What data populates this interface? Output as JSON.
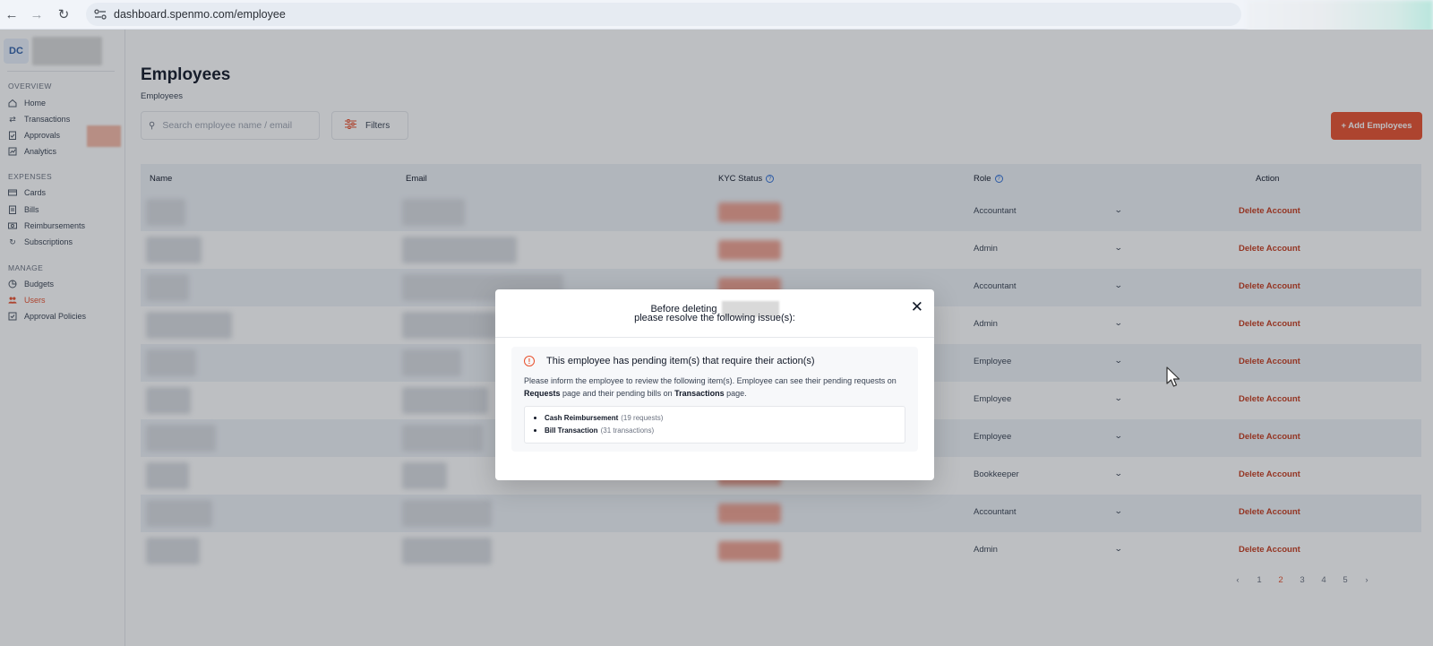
{
  "browser": {
    "url": "dashboard.spenmo.com/employee",
    "back_icon": "arrow-left-icon",
    "forward_icon": "arrow-right-icon",
    "reload_icon": "reload-icon"
  },
  "sidebar": {
    "org_initials": "DC",
    "sections": [
      {
        "title": "OVERVIEW",
        "items": [
          {
            "label": "Home",
            "icon": "home-icon"
          },
          {
            "label": "Transactions",
            "icon": "transfer-icon"
          },
          {
            "label": "Approvals",
            "icon": "clipboard-check-icon"
          },
          {
            "label": "Analytics",
            "icon": "chart-icon"
          }
        ]
      },
      {
        "title": "EXPENSES",
        "items": [
          {
            "label": "Cards",
            "icon": "card-icon"
          },
          {
            "label": "Bills",
            "icon": "bill-icon"
          },
          {
            "label": "Reimbursements",
            "icon": "cash-icon"
          },
          {
            "label": "Subscriptions",
            "icon": "refresh-icon"
          }
        ]
      },
      {
        "title": "MANAGE",
        "items": [
          {
            "label": "Budgets",
            "icon": "pie-icon"
          },
          {
            "label": "Users",
            "icon": "users-icon",
            "active": true
          },
          {
            "label": "Approval Policies",
            "icon": "policy-icon"
          }
        ]
      }
    ]
  },
  "page": {
    "title": "Employees",
    "breadcrumb": "Employees",
    "search_placeholder": "Search employee name / email",
    "filters_label": "Filters",
    "add_button": "+ Add Employees"
  },
  "table": {
    "headers": {
      "name": "Name",
      "email": "Email",
      "kyc": "KYC Status",
      "role": "Role",
      "action": "Action"
    },
    "rows": [
      {
        "role": "Accountant",
        "action": "Delete Account"
      },
      {
        "role": "Admin",
        "action": "Delete Account"
      },
      {
        "role": "Accountant",
        "action": "Delete Account"
      },
      {
        "role": "Admin",
        "action": "Delete Account"
      },
      {
        "role": "Employee",
        "action": "Delete Account"
      },
      {
        "role": "Employee",
        "action": "Delete Account"
      },
      {
        "role": "Employee",
        "action": "Delete Account"
      },
      {
        "role": "Bookkeeper",
        "action": "Delete Account"
      },
      {
        "role": "Accountant",
        "action": "Delete Account"
      },
      {
        "role": "Admin",
        "action": "Delete Account"
      }
    ]
  },
  "pagination": {
    "pages": [
      "1",
      "2",
      "3",
      "4",
      "5"
    ],
    "current": "2"
  },
  "modal": {
    "title_line1": "Before deleting",
    "title_line2": "please resolve the following issue(s):",
    "issue_title": "This employee has pending item(s) that require their action(s)",
    "desc_part1": "Please inform the employee to review the following item(s). Employee can see their pending requests on ",
    "desc_requests": "Requests",
    "desc_part2": " page and their pending bills on ",
    "desc_transactions": "Transactions",
    "desc_part3": " page.",
    "items": [
      {
        "label": "Cash Reimbursement",
        "count": "(19 requests)"
      },
      {
        "label": "Bill Transaction",
        "count": "(31 transactions)"
      }
    ]
  },
  "colors": {
    "accent": "#e8502d",
    "danger_text": "#c53a1c",
    "header_bg": "#eef2f7"
  }
}
